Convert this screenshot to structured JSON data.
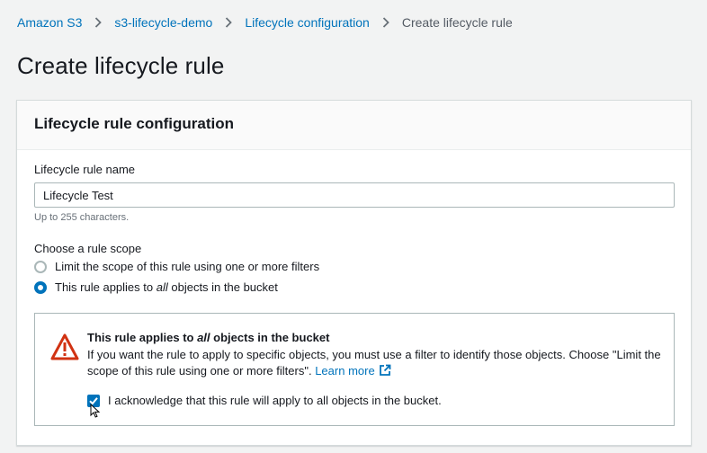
{
  "breadcrumb": {
    "items": [
      "Amazon S3",
      "s3-lifecycle-demo",
      "Lifecycle configuration"
    ],
    "current": "Create lifecycle rule",
    "separator_icon": "chevron-right-icon"
  },
  "page": {
    "title": "Create lifecycle rule"
  },
  "panel": {
    "title": "Lifecycle rule configuration",
    "rule_name": {
      "label": "Lifecycle rule name",
      "value": "Lifecycle Test",
      "hint": "Up to 255 characters."
    },
    "scope": {
      "label": "Choose a rule scope",
      "options": [
        {
          "label": "Limit the scope of this rule using one or more filters",
          "selected": false
        },
        {
          "label_before": "This rule applies to ",
          "label_em": "all",
          "label_after": " objects in the bucket",
          "selected": true
        }
      ]
    },
    "alert": {
      "type": "warning",
      "icon": "warning-icon",
      "title_before": "This rule applies to ",
      "title_em": "all",
      "title_after": " objects in the bucket",
      "body": "If you want the rule to apply to specific objects, you must use a filter to identify those objects. Choose \"Limit the scope of this rule using one or more filters\".",
      "link": "Learn more",
      "link_icon": "external-link-icon",
      "acknowledge": {
        "label": "I acknowledge that this rule will apply to all objects in the bucket.",
        "checked": true
      }
    }
  },
  "colors": {
    "link": "#0073bb",
    "warning": "#d13212",
    "accent": "#0073bb"
  }
}
